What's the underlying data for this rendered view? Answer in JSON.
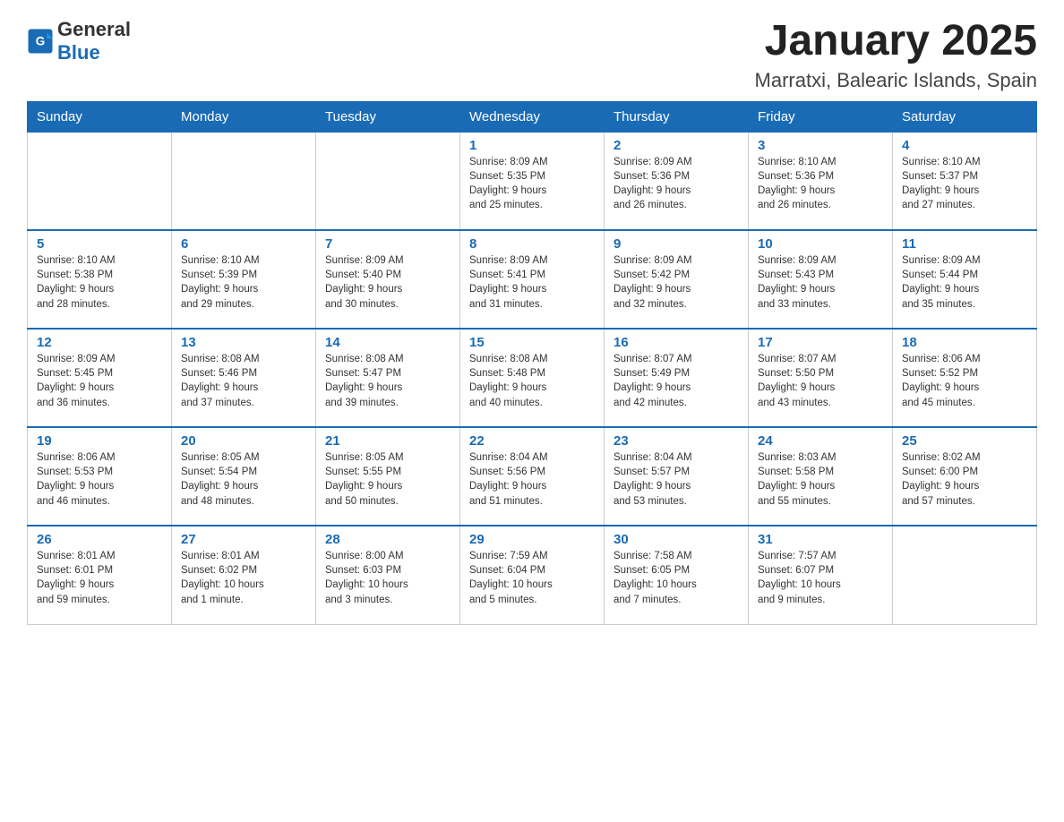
{
  "header": {
    "logo_general": "General",
    "logo_blue": "Blue",
    "title": "January 2025",
    "location": "Marratxi, Balearic Islands, Spain"
  },
  "weekdays": [
    "Sunday",
    "Monday",
    "Tuesday",
    "Wednesday",
    "Thursday",
    "Friday",
    "Saturday"
  ],
  "weeks": [
    [
      {
        "day": "",
        "info": ""
      },
      {
        "day": "",
        "info": ""
      },
      {
        "day": "",
        "info": ""
      },
      {
        "day": "1",
        "info": "Sunrise: 8:09 AM\nSunset: 5:35 PM\nDaylight: 9 hours\nand 25 minutes."
      },
      {
        "day": "2",
        "info": "Sunrise: 8:09 AM\nSunset: 5:36 PM\nDaylight: 9 hours\nand 26 minutes."
      },
      {
        "day": "3",
        "info": "Sunrise: 8:10 AM\nSunset: 5:36 PM\nDaylight: 9 hours\nand 26 minutes."
      },
      {
        "day": "4",
        "info": "Sunrise: 8:10 AM\nSunset: 5:37 PM\nDaylight: 9 hours\nand 27 minutes."
      }
    ],
    [
      {
        "day": "5",
        "info": "Sunrise: 8:10 AM\nSunset: 5:38 PM\nDaylight: 9 hours\nand 28 minutes."
      },
      {
        "day": "6",
        "info": "Sunrise: 8:10 AM\nSunset: 5:39 PM\nDaylight: 9 hours\nand 29 minutes."
      },
      {
        "day": "7",
        "info": "Sunrise: 8:09 AM\nSunset: 5:40 PM\nDaylight: 9 hours\nand 30 minutes."
      },
      {
        "day": "8",
        "info": "Sunrise: 8:09 AM\nSunset: 5:41 PM\nDaylight: 9 hours\nand 31 minutes."
      },
      {
        "day": "9",
        "info": "Sunrise: 8:09 AM\nSunset: 5:42 PM\nDaylight: 9 hours\nand 32 minutes."
      },
      {
        "day": "10",
        "info": "Sunrise: 8:09 AM\nSunset: 5:43 PM\nDaylight: 9 hours\nand 33 minutes."
      },
      {
        "day": "11",
        "info": "Sunrise: 8:09 AM\nSunset: 5:44 PM\nDaylight: 9 hours\nand 35 minutes."
      }
    ],
    [
      {
        "day": "12",
        "info": "Sunrise: 8:09 AM\nSunset: 5:45 PM\nDaylight: 9 hours\nand 36 minutes."
      },
      {
        "day": "13",
        "info": "Sunrise: 8:08 AM\nSunset: 5:46 PM\nDaylight: 9 hours\nand 37 minutes."
      },
      {
        "day": "14",
        "info": "Sunrise: 8:08 AM\nSunset: 5:47 PM\nDaylight: 9 hours\nand 39 minutes."
      },
      {
        "day": "15",
        "info": "Sunrise: 8:08 AM\nSunset: 5:48 PM\nDaylight: 9 hours\nand 40 minutes."
      },
      {
        "day": "16",
        "info": "Sunrise: 8:07 AM\nSunset: 5:49 PM\nDaylight: 9 hours\nand 42 minutes."
      },
      {
        "day": "17",
        "info": "Sunrise: 8:07 AM\nSunset: 5:50 PM\nDaylight: 9 hours\nand 43 minutes."
      },
      {
        "day": "18",
        "info": "Sunrise: 8:06 AM\nSunset: 5:52 PM\nDaylight: 9 hours\nand 45 minutes."
      }
    ],
    [
      {
        "day": "19",
        "info": "Sunrise: 8:06 AM\nSunset: 5:53 PM\nDaylight: 9 hours\nand 46 minutes."
      },
      {
        "day": "20",
        "info": "Sunrise: 8:05 AM\nSunset: 5:54 PM\nDaylight: 9 hours\nand 48 minutes."
      },
      {
        "day": "21",
        "info": "Sunrise: 8:05 AM\nSunset: 5:55 PM\nDaylight: 9 hours\nand 50 minutes."
      },
      {
        "day": "22",
        "info": "Sunrise: 8:04 AM\nSunset: 5:56 PM\nDaylight: 9 hours\nand 51 minutes."
      },
      {
        "day": "23",
        "info": "Sunrise: 8:04 AM\nSunset: 5:57 PM\nDaylight: 9 hours\nand 53 minutes."
      },
      {
        "day": "24",
        "info": "Sunrise: 8:03 AM\nSunset: 5:58 PM\nDaylight: 9 hours\nand 55 minutes."
      },
      {
        "day": "25",
        "info": "Sunrise: 8:02 AM\nSunset: 6:00 PM\nDaylight: 9 hours\nand 57 minutes."
      }
    ],
    [
      {
        "day": "26",
        "info": "Sunrise: 8:01 AM\nSunset: 6:01 PM\nDaylight: 9 hours\nand 59 minutes."
      },
      {
        "day": "27",
        "info": "Sunrise: 8:01 AM\nSunset: 6:02 PM\nDaylight: 10 hours\nand 1 minute."
      },
      {
        "day": "28",
        "info": "Sunrise: 8:00 AM\nSunset: 6:03 PM\nDaylight: 10 hours\nand 3 minutes."
      },
      {
        "day": "29",
        "info": "Sunrise: 7:59 AM\nSunset: 6:04 PM\nDaylight: 10 hours\nand 5 minutes."
      },
      {
        "day": "30",
        "info": "Sunrise: 7:58 AM\nSunset: 6:05 PM\nDaylight: 10 hours\nand 7 minutes."
      },
      {
        "day": "31",
        "info": "Sunrise: 7:57 AM\nSunset: 6:07 PM\nDaylight: 10 hours\nand 9 minutes."
      },
      {
        "day": "",
        "info": ""
      }
    ]
  ]
}
